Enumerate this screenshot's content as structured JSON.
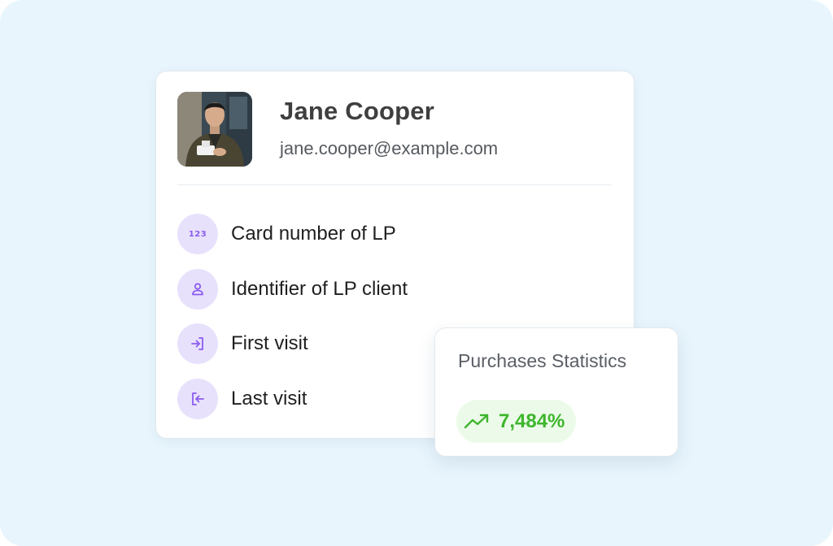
{
  "profile": {
    "name": "Jane Cooper",
    "email": "jane.cooper@example.com",
    "avatar": "person-photo"
  },
  "fields": [
    {
      "label": "Card number of LP",
      "icon": "number-123-icon"
    },
    {
      "label": "Identifier of LP client",
      "icon": "user-icon"
    },
    {
      "label": "First visit",
      "icon": "login-icon"
    },
    {
      "label": "Last visit",
      "icon": "logout-icon"
    }
  ],
  "stats": {
    "title": "Purchases Statistics",
    "value": "7,484%",
    "icon": "trending-up-icon",
    "value_color": "#3eb52d"
  },
  "colors": {
    "background": "#e8f5fd",
    "icon_bg": "#e8e1fc",
    "accent": "#8a5cf0",
    "badge_bg": "#ecfbe9"
  }
}
